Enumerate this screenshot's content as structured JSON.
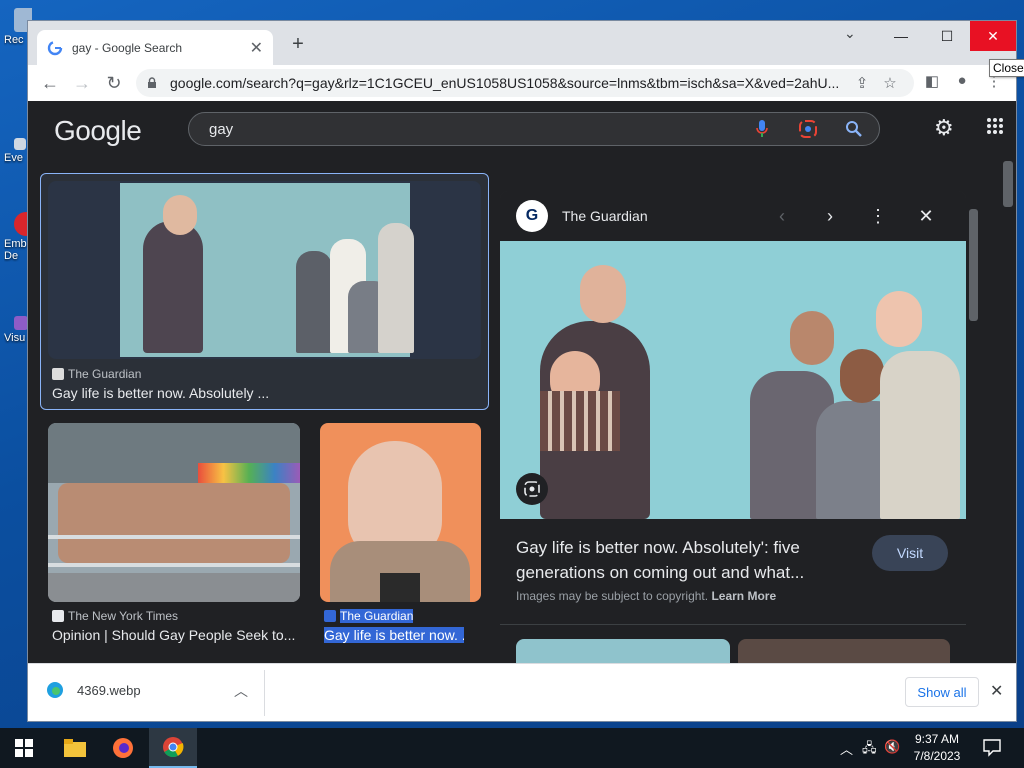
{
  "desktop": {
    "icons": [
      {
        "label": "Rec"
      },
      {
        "label": "Eve"
      },
      {
        "label": "Emb De"
      },
      {
        "label": "Visu"
      }
    ]
  },
  "browser": {
    "tab_title": "gay - Google Search",
    "url": "google.com/search?q=gay&rlz=1C1GCEU_enUS1058US1058&source=lnms&tbm=isch&sa=X&ved=2ahU...",
    "close_tooltip": "Close"
  },
  "google": {
    "logo": "Google",
    "query": "gay"
  },
  "results": [
    {
      "source": "The Guardian",
      "title": "Gay life is better now. Absolutely ...",
      "selected": true
    },
    {
      "source": "The New York Times",
      "title": "Opinion | Should Gay People Seek to..."
    },
    {
      "source": "The Guardian",
      "title": "Gay life is better now. ...",
      "highlighted": true
    }
  ],
  "panel": {
    "source": "The Guardian",
    "title": "Gay life is better now. Absolutely': five generations on coming out and what...",
    "visit_label": "Visit",
    "copyright_prefix": "Images may be subject to copyright.",
    "learn_more": "Learn More"
  },
  "downloads": {
    "file": "4369.webp",
    "show_all": "Show all"
  },
  "taskbar": {
    "time": "9:37 AM",
    "date": "7/8/2023"
  },
  "colors": {
    "accent": "#8ab4f8",
    "close_red": "#e81123",
    "panel_bg": "#303134",
    "selection": "#3367d6"
  }
}
